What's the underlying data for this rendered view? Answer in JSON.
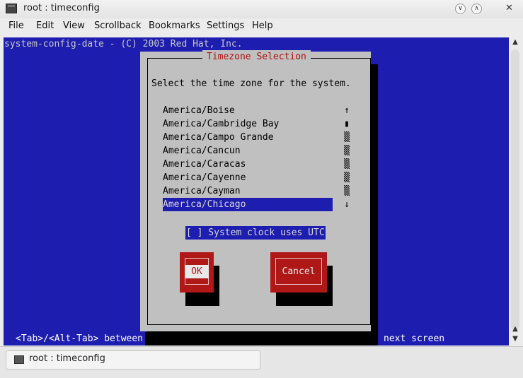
{
  "window": {
    "title": "root : timeconfig"
  },
  "menubar": [
    "File",
    "Edit",
    "View",
    "Scrollback",
    "Bookmarks",
    "Settings",
    "Help"
  ],
  "terminal": {
    "header": "system-config-date - (C) 2003 Red Hat, Inc.",
    "footer_left": "<Tab>/<Alt-Tab> between",
    "footer_right": "next screen"
  },
  "dialog": {
    "title": "Timezone Selection",
    "prompt": "Select the time zone for the system.",
    "timezones": [
      "America/Boise",
      "America/Cambridge Bay",
      "America/Campo Grande",
      "America/Cancun",
      "America/Caracas",
      "America/Cayenne",
      "America/Cayman",
      "America/Chicago"
    ],
    "selected_timezone": "America/Chicago",
    "scrollbar": [
      "↑",
      "▮",
      "▒",
      "▒",
      "▒",
      "▒",
      "▒",
      "↓"
    ],
    "utc_checkbox": "[ ] System clock uses UTC",
    "ok_label": "OK",
    "cancel_label": "Cancel"
  },
  "taskbar": {
    "task_label": "root : timeconfig"
  }
}
